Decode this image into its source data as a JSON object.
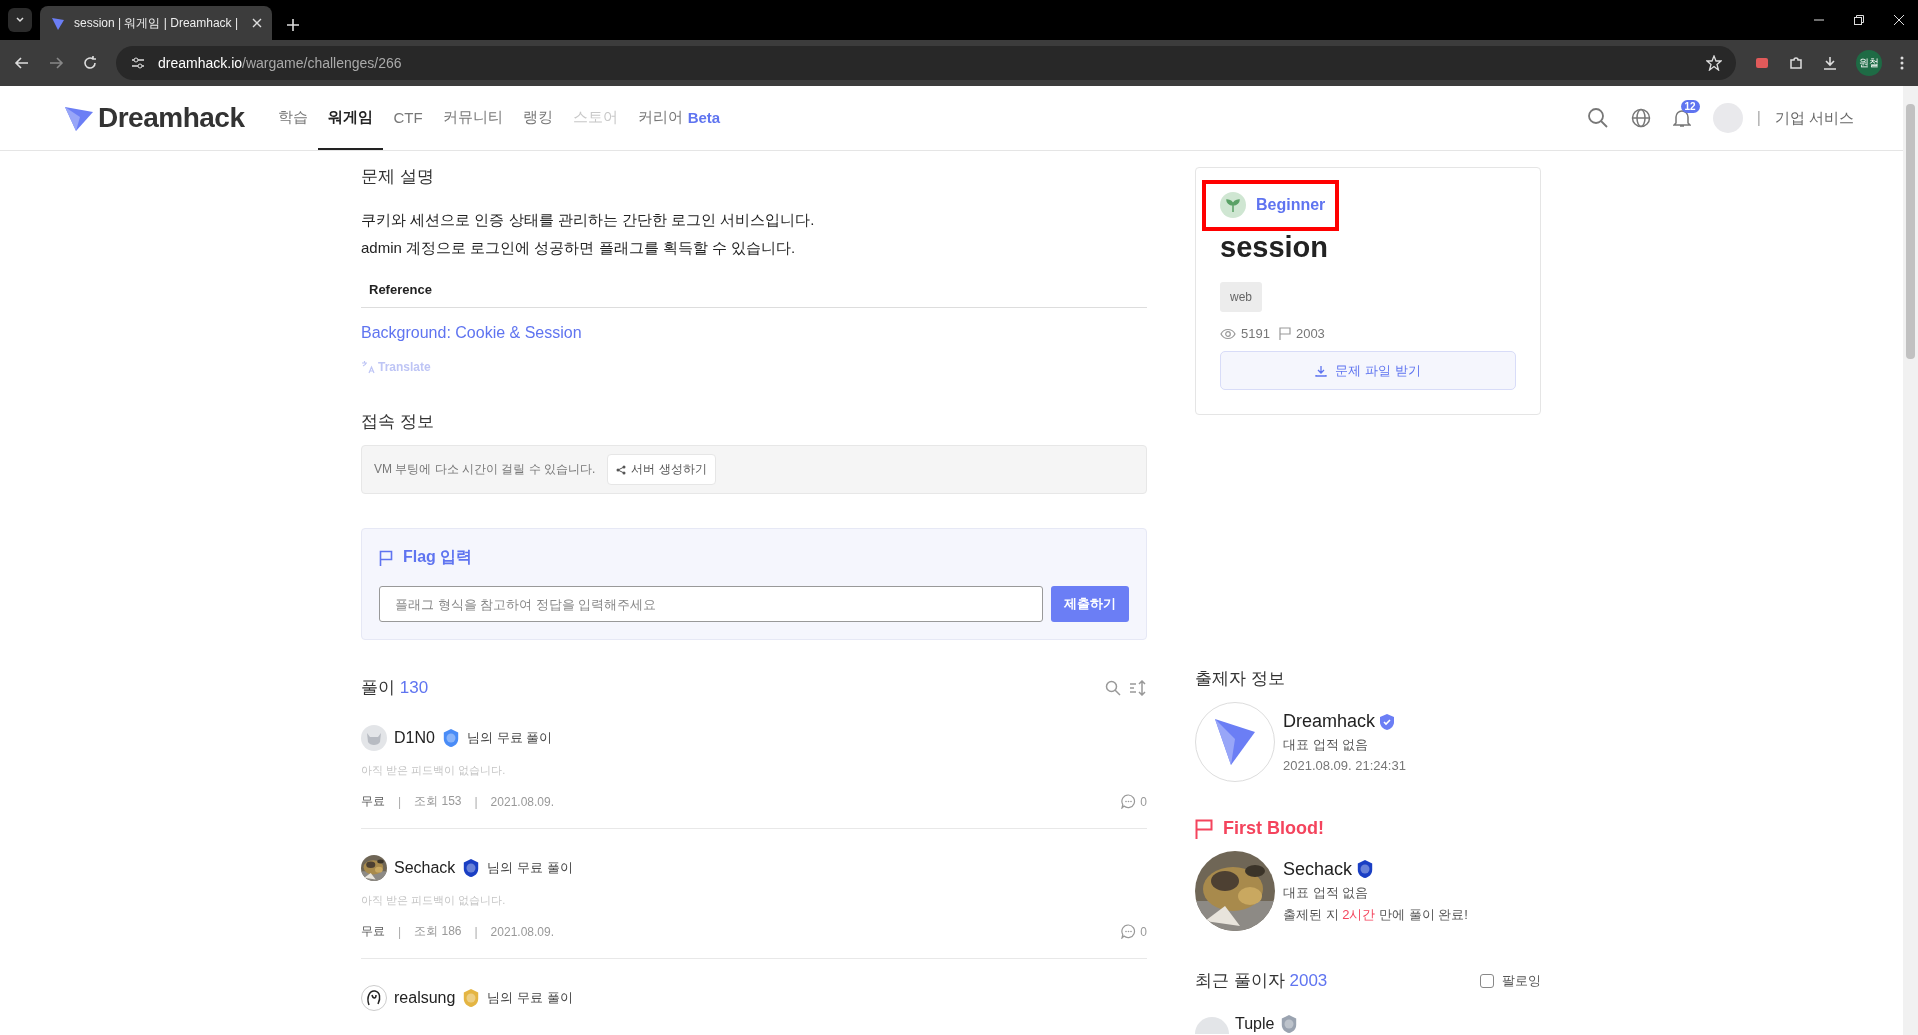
{
  "browser": {
    "tab_title": "session | 워게임 | Dreamhack |",
    "url_host": "dreamhack.io",
    "url_path": "/wargame/challenges/266",
    "profile": "원철"
  },
  "nav": {
    "logo": "Dreamhack",
    "items": [
      {
        "label": "학습",
        "selected": false,
        "disabled": false
      },
      {
        "label": "워게임",
        "selected": true,
        "disabled": false
      },
      {
        "label": "CTF",
        "selected": false,
        "disabled": false
      },
      {
        "label": "커뮤니티",
        "selected": false,
        "disabled": false
      },
      {
        "label": "랭킹",
        "selected": false,
        "disabled": false
      },
      {
        "label": "스토어",
        "selected": false,
        "disabled": true
      },
      {
        "label": "커리어",
        "selected": false,
        "disabled": false,
        "badge": "Beta"
      }
    ],
    "notification_count": "12",
    "separator": "|",
    "enterprise": "기업 서비스"
  },
  "description": {
    "title": "문제 설명",
    "lines": [
      "쿠키와 세션으로 인증 상태를 관리하는 간단한 로그인 서비스입니다.",
      "admin 계정으로 로그인에 성공하면 플래그를 획득할 수 있습니다."
    ],
    "reference_heading": "Reference",
    "reference_link": "Background: Cookie & Session",
    "translate": "Translate"
  },
  "connection": {
    "title": "접속 정보",
    "note": "VM 부팅에 다소 시간이 걸릴 수 있습니다.",
    "button": "서버 생성하기"
  },
  "flag": {
    "title": "Flag 입력",
    "placeholder": "플래그 형식을 참고하여 정답을 입력해주세요",
    "submit": "제출하기"
  },
  "solutions": {
    "title": "풀이",
    "count": "130",
    "items": [
      {
        "user": "D1N0",
        "badge": {
          "kind": "sapphire"
        },
        "avatar": {
          "kind": "cat"
        },
        "suffix": "님의 무료 풀이",
        "feedback": "아직 받은 피드백이 없습니다.",
        "price": "무료",
        "separator": "|",
        "views": "조회 153",
        "date": "2021.08.09.",
        "comments": "0"
      },
      {
        "user": "Sechack",
        "badge": {
          "kind": "master"
        },
        "suffix": "님의 무료 풀이",
        "feedback": "아직 받은 피드백이 없습니다.",
        "price": "무료",
        "separator": "|",
        "views": "조회 186",
        "date": "2021.08.09.",
        "comments": "0"
      },
      {
        "user": "realsung",
        "badge": {
          "kind": "gold"
        },
        "avatar": {
          "kind": "sketch"
        },
        "suffix": "님의 무료 풀이"
      }
    ]
  },
  "challenge": {
    "level": {
      "label": "Beginner",
      "highlighted": true
    },
    "title": "session",
    "tags": [
      "web"
    ],
    "views": "5191",
    "solves": "2003",
    "download": "문제 파일 받기"
  },
  "author": {
    "title": "출제자 정보",
    "name": "Dreamhack",
    "verified": true,
    "achievement": "대표 업적 없음",
    "date": "2021.08.09. 21:24:31"
  },
  "first_blood": {
    "title": "First Blood!",
    "name": "Sechack",
    "badge": {
      "kind": "master"
    },
    "achievement": "대표 업적 없음",
    "note_before": "출제된 지 ",
    "note_highlight": "2시간",
    "note_after": " 만에 풀이 완료!"
  },
  "recent": {
    "title": "최근 풀이자",
    "count": "2003",
    "follow": {
      "label": "팔로잉",
      "checked": false
    },
    "items": [
      {
        "name": "Tuple",
        "badge": {
          "kind": "silver"
        }
      }
    ]
  }
}
